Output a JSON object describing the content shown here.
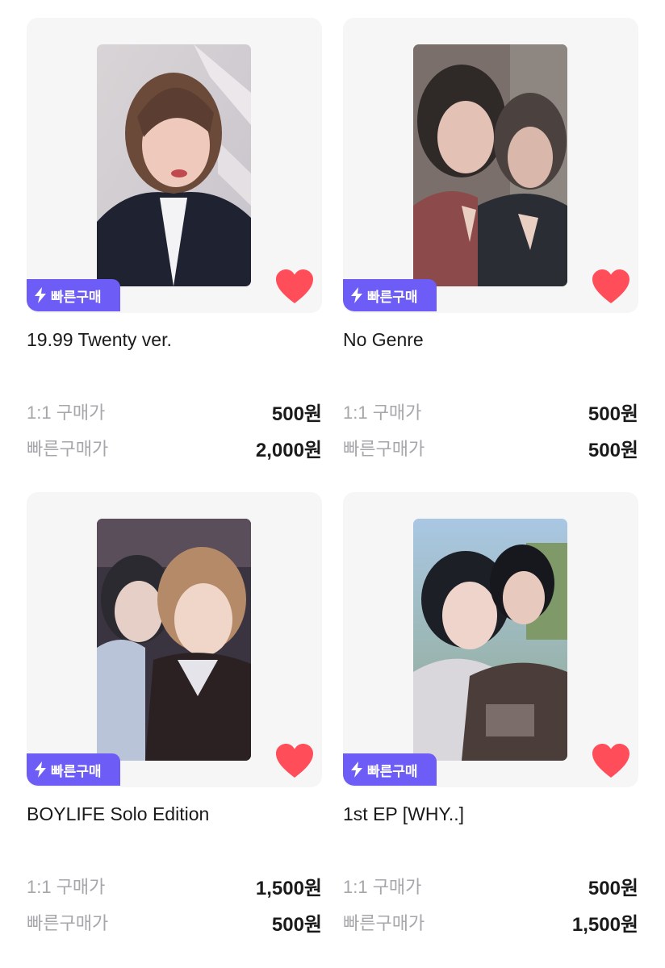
{
  "quick_buy_badge": "빠른구매",
  "price_labels": {
    "one_to_one": "1:1 구매가",
    "quick": "빠른구매가"
  },
  "colors": {
    "accent": "#6d5cf5",
    "heart": "#ff4e5a",
    "card_bg": "#f6f6f7",
    "label_gray": "#a6a6ab"
  },
  "icons": {
    "badge": "lightning-bolt-icon",
    "wishlist": "heart-icon"
  },
  "products": [
    {
      "title": "19.99 Twenty ver.",
      "price_1to1": "500원",
      "price_quick": "2,000원",
      "liked": true
    },
    {
      "title": "No Genre",
      "price_1to1": "500원",
      "price_quick": "500원",
      "liked": true
    },
    {
      "title": "BOYLIFE Solo Edition",
      "price_1to1": "1,500원",
      "price_quick": "500원",
      "liked": true
    },
    {
      "title": "1st EP [WHY..]",
      "price_1to1": "500원",
      "price_quick": "1,500원",
      "liked": true
    }
  ]
}
